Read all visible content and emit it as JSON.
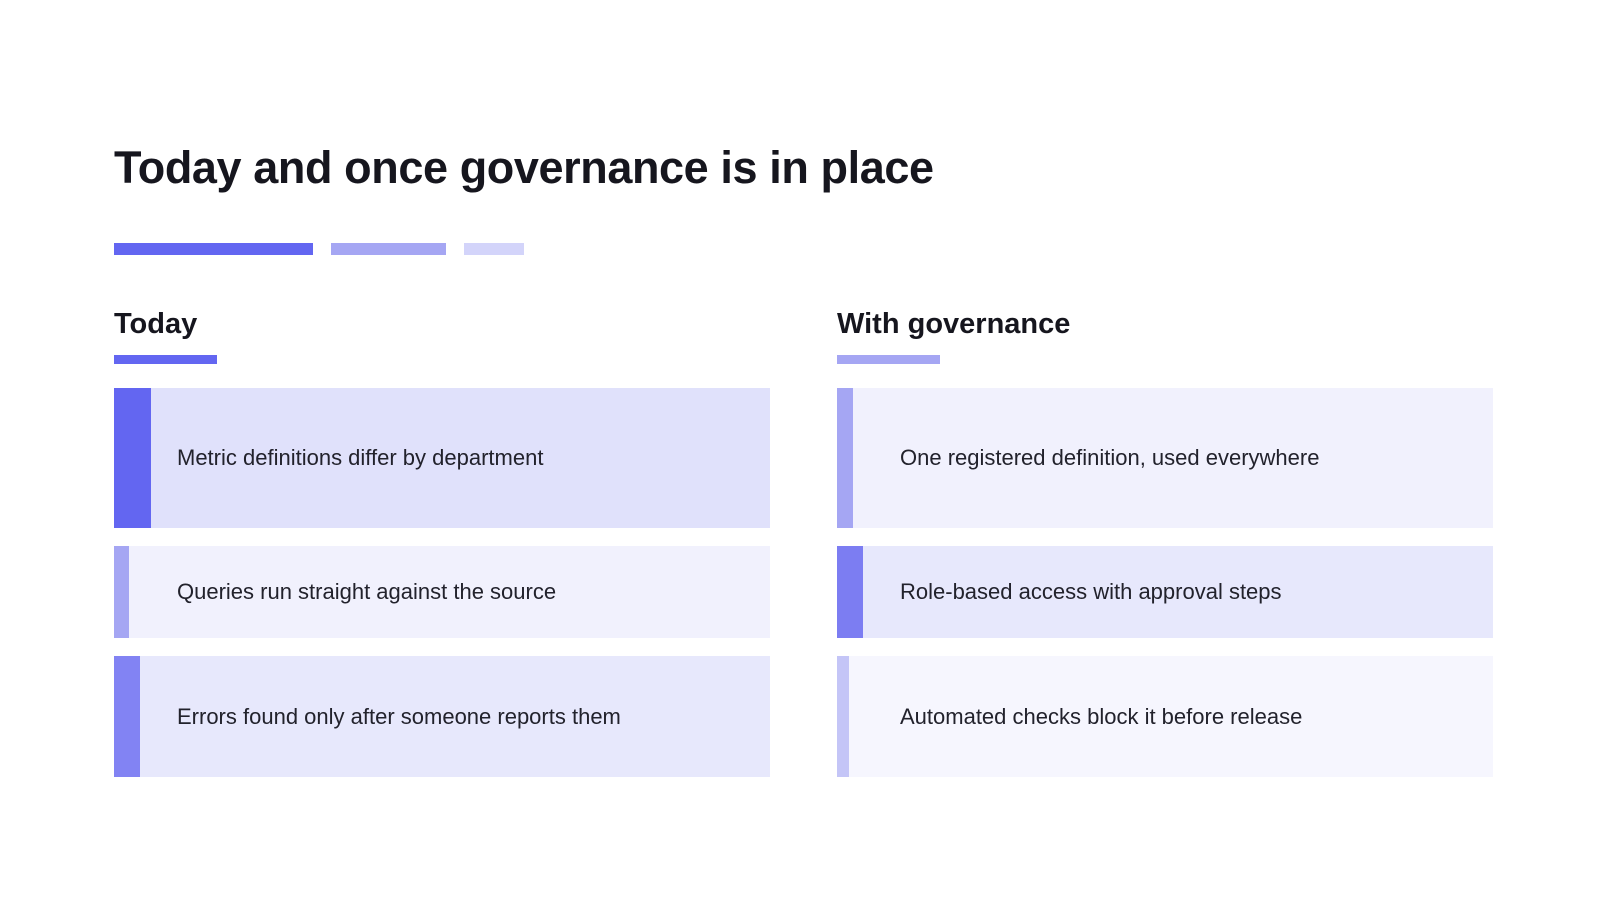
{
  "slide": {
    "title": "Today and once governance is in place"
  },
  "colors": {
    "accent_primary": "#6366f1",
    "accent_secondary": "#a5a6f3",
    "accent_light": "#d3d4fa"
  },
  "columns": [
    {
      "heading": "Today",
      "items": [
        {
          "label": "Metric definitions differ by department"
        },
        {
          "label": "Queries run straight against the source"
        },
        {
          "label": "Errors found only after someone reports them"
        }
      ]
    },
    {
      "heading": "With governance",
      "items": [
        {
          "label": "One registered definition, used everywhere"
        },
        {
          "label": "Role-based access with approval steps"
        },
        {
          "label": "Automated checks block it before release"
        }
      ]
    }
  ]
}
